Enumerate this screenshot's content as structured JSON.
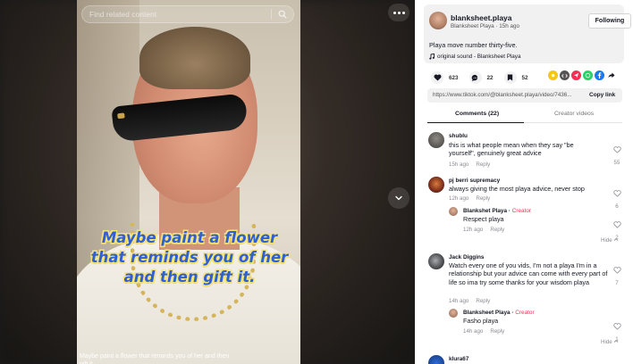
{
  "search": {
    "placeholder": "Find related content"
  },
  "video": {
    "overlay_text": "Maybe paint a flower that reminds you of her and then gift it.",
    "caption": "Maybe paint a flower that reminds you of her and then gift it."
  },
  "author": {
    "username": "blanksheet.playa",
    "display_line": "Blanksheet Playa · 15h ago",
    "follow_label": "Following",
    "description": "Playa move number thirty-five.",
    "sound": "original sound - Blanksheet Playa"
  },
  "stats": {
    "likes": "623",
    "comments": "22",
    "saves": "52"
  },
  "share_icons": [
    "embed-icon",
    "code-icon",
    "paper-plane-icon",
    "whatsapp-icon",
    "facebook-icon",
    "share-arrow-icon"
  ],
  "link": {
    "url": "https://www.tiktok.com/@blanksheet.playa/video/7436...",
    "copy_label": "Copy link"
  },
  "tabs": [
    {
      "label": "Comments (22)"
    },
    {
      "label": "Creator videos"
    }
  ],
  "comments": [
    {
      "user": "shublu",
      "text": "this is what people mean when they say \"be yourself\", genuinely great advice",
      "time": "15h ago",
      "reply": "Reply",
      "likes": "55"
    },
    {
      "user": "pj berri supremacy",
      "text": "always giving the most playa advice, never stop",
      "time": "12h ago",
      "reply": "Reply",
      "likes": "6",
      "replies": [
        {
          "user": "Blankshet Playa",
          "tag": "Creator",
          "text": "Respect playa",
          "time": "12h ago",
          "reply": "Reply",
          "likes": "2"
        }
      ],
      "hide": "Hide"
    },
    {
      "user": "Jack Diggins",
      "text": "Watch every one of you vids, I'm not a playa I'm in a relationship but your advice can come with every part of life so ima try some thanks for your wisdom playa",
      "time": "14h ago",
      "reply": "Reply",
      "likes": "7",
      "replies": [
        {
          "user": "Blanksheet Playa",
          "tag": "Creator",
          "text": "Fasho playa",
          "time": "14h ago",
          "reply": "Reply",
          "likes": "1"
        }
      ],
      "hide": "Hide"
    },
    {
      "user": "klura67"
    }
  ],
  "colors": {
    "accent": "#fe2c55",
    "overlay_text": "#2f5fd4",
    "overlay_outline": "#f4e27a"
  }
}
